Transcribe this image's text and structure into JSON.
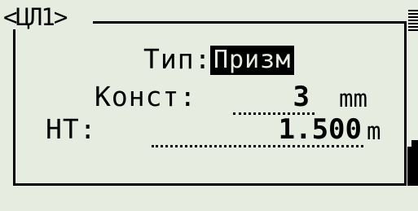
{
  "dialog": {
    "title": "<ЦЛ1>"
  },
  "fields": {
    "type": {
      "label": "Тип:",
      "value": "Призм"
    },
    "const": {
      "label": "Конст:",
      "value": "3",
      "unit": "mm"
    },
    "ht": {
      "label": "HT:",
      "value": "1.500",
      "unit": "m"
    }
  }
}
